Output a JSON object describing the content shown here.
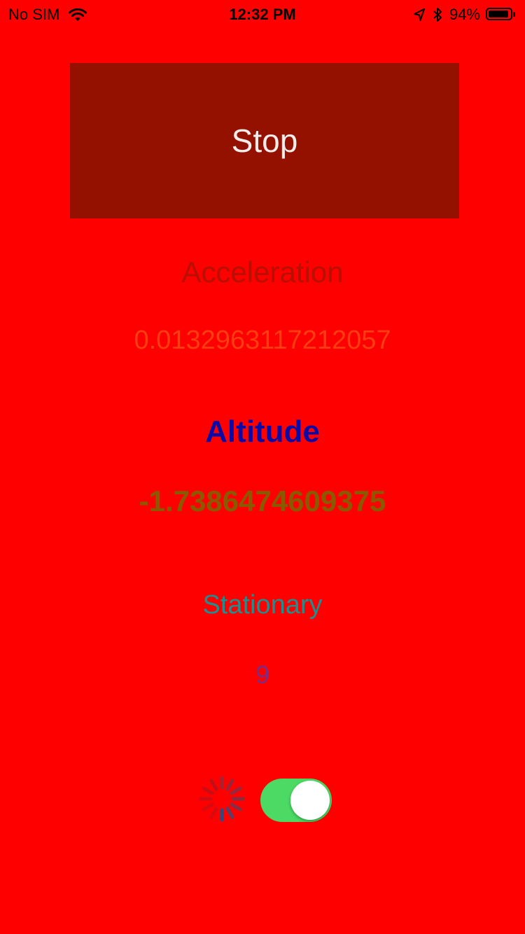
{
  "status_bar": {
    "carrier": "No SIM",
    "time": "12:32 PM",
    "battery_percent": "94%",
    "battery_level": 0.94,
    "icons": [
      "wifi-icon",
      "location-arrow-icon",
      "bluetooth-icon",
      "battery-icon"
    ]
  },
  "stop_button": {
    "label": "Stop",
    "color": "#941100"
  },
  "acceleration": {
    "title": "Acceleration",
    "value": "0.0132963117212057"
  },
  "altitude": {
    "title": "Altitude",
    "value": "-1.7386474609375"
  },
  "stationary": {
    "title": "Stationary",
    "value": "9"
  },
  "toggle": {
    "on": true,
    "color": "#4cd964"
  },
  "colors": {
    "background": "#ff0000"
  }
}
